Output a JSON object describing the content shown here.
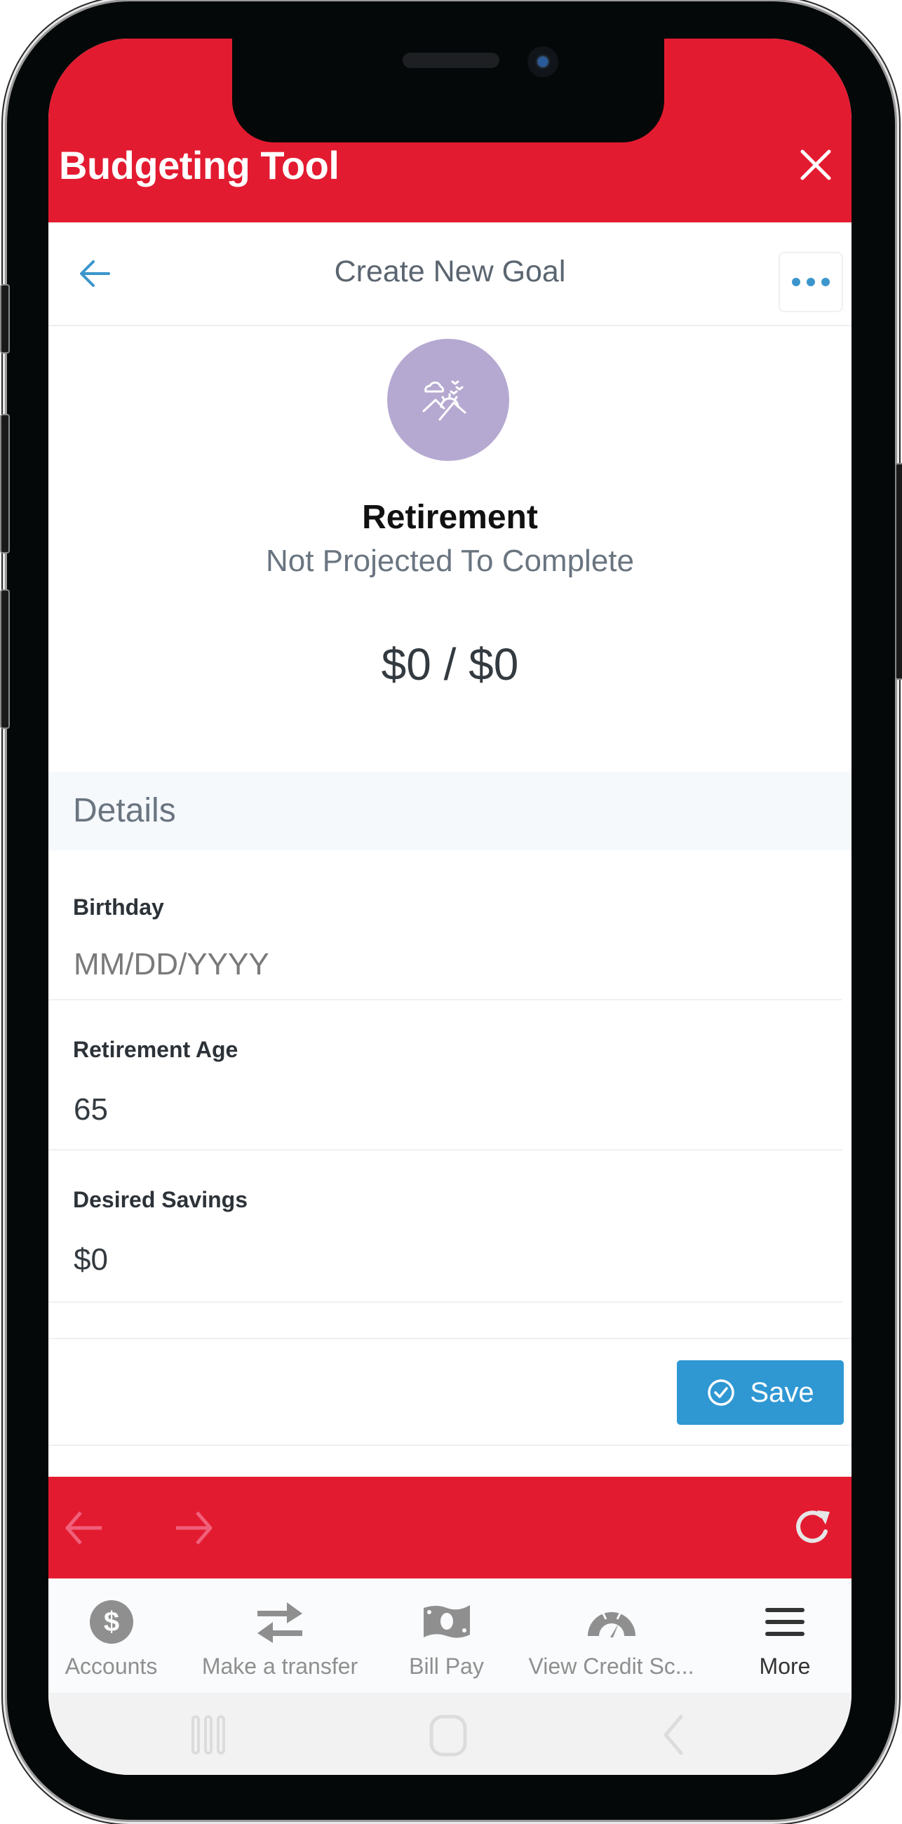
{
  "app": {
    "title": "Budgeting Tool",
    "close_icon": "close-icon",
    "header_color": "#e31b30"
  },
  "subheader": {
    "title": "Create New Goal",
    "back_icon": "arrow-left-icon",
    "more_icon": "ellipsis-icon"
  },
  "goal": {
    "icon": "retirement-landscape-icon",
    "icon_bg_color": "#b5a9d1",
    "name": "Retirement",
    "status": "Not Projected To Complete",
    "amount": "$0 / $0"
  },
  "details": {
    "title": "Details",
    "fields": [
      {
        "label": "Birthday",
        "value": "",
        "placeholder": "MM/DD/YYYY"
      },
      {
        "label": "Retirement Age",
        "value": "65",
        "placeholder": ""
      },
      {
        "label": "Desired Savings",
        "value": "$0",
        "placeholder": ""
      }
    ]
  },
  "actions": {
    "save_label": "Save",
    "save_icon": "check-circle-icon",
    "save_color": "#2f98d3"
  },
  "browser_bar": {
    "back_icon": "arrow-left-icon",
    "forward_icon": "arrow-right-icon",
    "reload_icon": "reload-icon"
  },
  "tabbar": {
    "items": [
      {
        "label": "Accounts",
        "icon": "dollar-circle-icon",
        "active": false
      },
      {
        "label": "Make a transfer",
        "icon": "transfer-arrows-icon",
        "active": false
      },
      {
        "label": "Bill Pay",
        "icon": "money-bill-icon",
        "active": false
      },
      {
        "label": "View Credit Sc...",
        "icon": "gauge-icon",
        "active": false
      },
      {
        "label": "More",
        "icon": "menu-icon",
        "active": true
      }
    ]
  },
  "system_nav": {
    "recent_icon": "recent-apps-icon",
    "home_icon": "home-icon",
    "back_icon": "back-chevron-icon"
  }
}
